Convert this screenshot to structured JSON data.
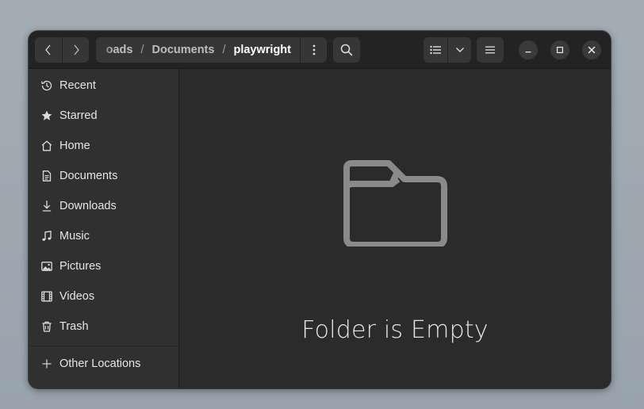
{
  "headerbar": {
    "path": [
      "oads",
      "Documents",
      "playwright"
    ],
    "path_separator": "/",
    "icons": {
      "back": "chevron-left-icon",
      "forward": "chevron-right-icon",
      "path_menu": "vertical-dots-icon",
      "search": "search-icon",
      "view": "list-view-icon",
      "view_dropdown": "chevron-down-icon",
      "menu": "hamburger-icon",
      "minimize": "minimize-icon",
      "maximize": "maximize-icon",
      "close": "close-icon"
    }
  },
  "sidebar": {
    "items": [
      {
        "label": "Recent",
        "icon": "clock-icon"
      },
      {
        "label": "Starred",
        "icon": "star-icon"
      },
      {
        "label": "Home",
        "icon": "home-icon"
      },
      {
        "label": "Documents",
        "icon": "document-icon"
      },
      {
        "label": "Downloads",
        "icon": "download-icon"
      },
      {
        "label": "Music",
        "icon": "music-note-icon"
      },
      {
        "label": "Pictures",
        "icon": "picture-icon"
      },
      {
        "label": "Videos",
        "icon": "film-icon"
      },
      {
        "label": "Trash",
        "icon": "trash-icon"
      }
    ],
    "other_locations": {
      "label": "Other Locations",
      "icon": "plus-icon"
    }
  },
  "content": {
    "empty_label": "Folder is Empty",
    "empty_icon": "folder-icon"
  },
  "colors": {
    "window_bg": "#2b2b2b",
    "headerbar_bg": "#232323",
    "sidebar_bg": "#303030",
    "button_bg": "#363636",
    "text": "#e6e6e6",
    "empty_icon": "#8a8a8a"
  }
}
